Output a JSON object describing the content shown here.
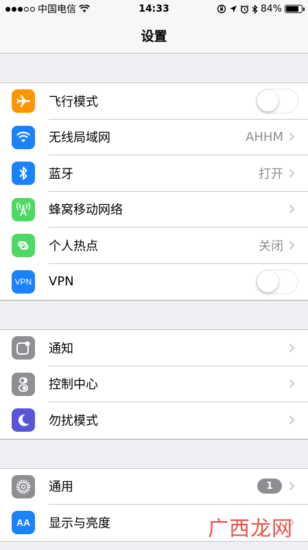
{
  "status_bar": {
    "carrier": "中国电信",
    "time": "14:33",
    "battery": "84%",
    "battery_level": 0.84
  },
  "nav": {
    "title": "设置"
  },
  "groups": [
    {
      "items": [
        {
          "label": "飞行模式",
          "icon": "airplane-icon",
          "color": "#ff9500",
          "accessory": "toggle",
          "toggle_on": false
        },
        {
          "label": "无线局域网",
          "icon": "wifi-icon",
          "color": "#1a82fb",
          "value": "AHHM"
        },
        {
          "label": "蓝牙",
          "icon": "bluetooth-icon",
          "color": "#1a82fb",
          "value": "打开"
        },
        {
          "label": "蜂窝移动网络",
          "icon": "cellular-icon",
          "color": "#4cd964"
        },
        {
          "label": "个人热点",
          "icon": "hotspot-icon",
          "color": "#4cd964",
          "value": "关闭"
        },
        {
          "label": "VPN",
          "icon": "vpn-icon",
          "icon_text": "VPN",
          "color": "#1a82fb",
          "accessory": "toggle",
          "toggle_on": false
        }
      ]
    },
    {
      "items": [
        {
          "label": "通知",
          "icon": "notifications-icon",
          "color": "#8e8e93"
        },
        {
          "label": "控制中心",
          "icon": "control-center-icon",
          "color": "#8e8e93"
        },
        {
          "label": "勿扰模式",
          "icon": "moon-icon",
          "color": "#5856d6"
        }
      ]
    },
    {
      "items": [
        {
          "label": "通用",
          "icon": "gear-icon",
          "color": "#8e8e93",
          "badge": "1"
        },
        {
          "label": "显示与亮度",
          "icon": "display-icon",
          "icon_text": "AA",
          "color": "#1a82fb"
        }
      ]
    }
  ],
  "watermark": "广西龙网"
}
